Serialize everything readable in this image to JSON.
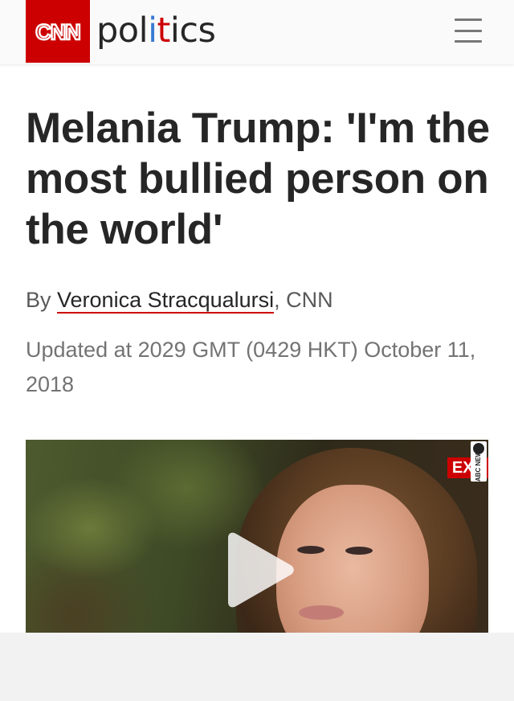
{
  "header": {
    "logo_text": "CNN",
    "section": {
      "part1": "pol",
      "part2": "i",
      "part3": "t",
      "part4": "i",
      "part5": "cs"
    },
    "menu_icon": "hamburger-menu-icon"
  },
  "article": {
    "headline": "Melania Trump: 'I'm the most bullied person on the world'",
    "byline": {
      "prefix": "By ",
      "author": "Veronica Stracqualursi",
      "suffix": ", CNN"
    },
    "timestamp": "Updated at 2029 GMT (0429 HKT) October 11, 2018"
  },
  "video": {
    "badge_text": "EXC",
    "watermark_text": "ABC NEWS",
    "play_icon": "play-icon"
  },
  "colors": {
    "brand_red": "#cc0000",
    "accent_blue": "#3a7ad1",
    "text_dark": "#262626"
  }
}
